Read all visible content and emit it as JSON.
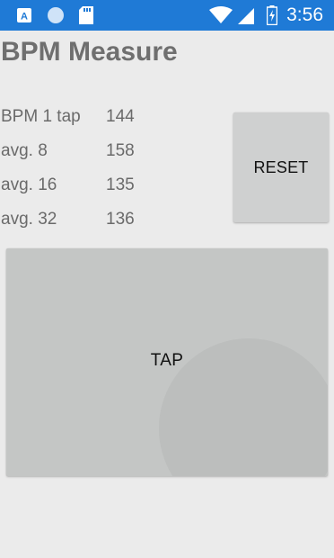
{
  "status_bar": {
    "time": "3:56",
    "icons": [
      "app-a-icon",
      "circle-icon",
      "sd-card-icon",
      "wifi-icon",
      "signal-icon",
      "battery-charging-icon"
    ]
  },
  "page": {
    "title": "BPM Measure"
  },
  "stats": [
    {
      "label": "BPM 1 tap",
      "value": "144"
    },
    {
      "label": "avg. 8",
      "value": "158"
    },
    {
      "label": "avg. 16",
      "value": "135"
    },
    {
      "label": "avg. 32",
      "value": "136"
    }
  ],
  "buttons": {
    "reset_label": "RESET",
    "tap_label": "TAP"
  },
  "colors": {
    "status_bar": "#1f7ad6",
    "background": "#ebebeb",
    "button": "#cfd0d0",
    "tap_area": "#c4c6c5"
  }
}
